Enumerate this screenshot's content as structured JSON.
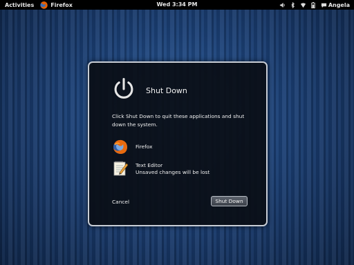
{
  "topbar": {
    "activities": "Activities",
    "app_name": "Firefox",
    "clock": "Wed 3:34 PM",
    "user": "Angela",
    "tray_icons": [
      "volume-icon",
      "bluetooth-icon",
      "wifi-icon",
      "battery-icon",
      "chat-icon"
    ]
  },
  "dialog": {
    "title": "Shut Down",
    "description": "Click Shut Down to quit these applications and shut down the system.",
    "apps": [
      {
        "name": "Firefox",
        "status": ""
      },
      {
        "name": "Text Editor",
        "status": "Unsaved changes will be lost"
      }
    ],
    "cancel_label": "Cancel",
    "confirm_label": "Shut Down"
  },
  "colors": {
    "panel_bg": "#000000",
    "desktop_blue": "#1b3f74",
    "dialog_bg": "#0a0e16",
    "dialog_border": "#c9ced6"
  }
}
